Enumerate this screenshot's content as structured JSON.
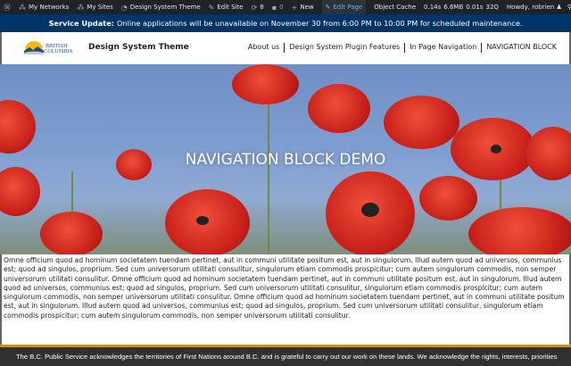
{
  "admin_bar": {
    "items": [
      "My Networks",
      "My Sites",
      "Design System Theme",
      "Edit Site",
      "8",
      "0",
      "New",
      "Edit Page",
      "Object Cache",
      "0.14s",
      "6.6MB",
      "0.01s",
      "32Q"
    ],
    "greeting": "Howdy, robrien"
  },
  "banner": {
    "label": "Service Update:",
    "text": "Online applications will be unavailable on November 30 from 6:00 PM to 10:00 PM for scheduled maintenance."
  },
  "header": {
    "logo_text": "British Columbia",
    "site_title": "Design System Theme",
    "nav": [
      "About us",
      "Design System Plugin Features",
      "In Page Navigation",
      "NAVIGATION BLOCK"
    ]
  },
  "hero": {
    "title": "NAVIGATION BLOCK DEMO"
  },
  "content": {
    "paragraph": "Omne officium quod ad hominum societatem tuendam pertinet, aut in communi utilitate positum est, aut in singulorum. Illud autem quod ad universos, communius est; quod ad singulos, proprium. Sed cum universorum utilitati consulitur, singulorum etiam commodis prospicitur; cum autem singulorum commodis, non semper universorum utilitati consulitur. Omne officium quod ad hominum societatem tuendam pertinet, aut in communi utilitate positum est, aut in singulorum. Illud autem quod ad universos, communius est; quod ad singulos, proprium. Sed cum universorum utilitati consulitur, singulorum etiam commodis prospicitur; cum autem singulorum commodis, non semper universorum utilitati consulitur. Omne officium quod ad hominum societatem tuendam pertinet, aut in communi utilitate positum est, aut in singulorum. Illud autem quod ad universos, communius est; quod ad singulos, proprium. Sed cum universorum utilitati consulitur, singulorum etiam commodis prospicitur; cum autem singulorum commodis, non semper universorum utilitati consulitur."
  },
  "footer": {
    "text": "The B.C. Public Service acknowledges the territories of First Nations around B.C. and is grateful to carry out our work on these lands. We acknowledge the rights, interests, priorities"
  }
}
